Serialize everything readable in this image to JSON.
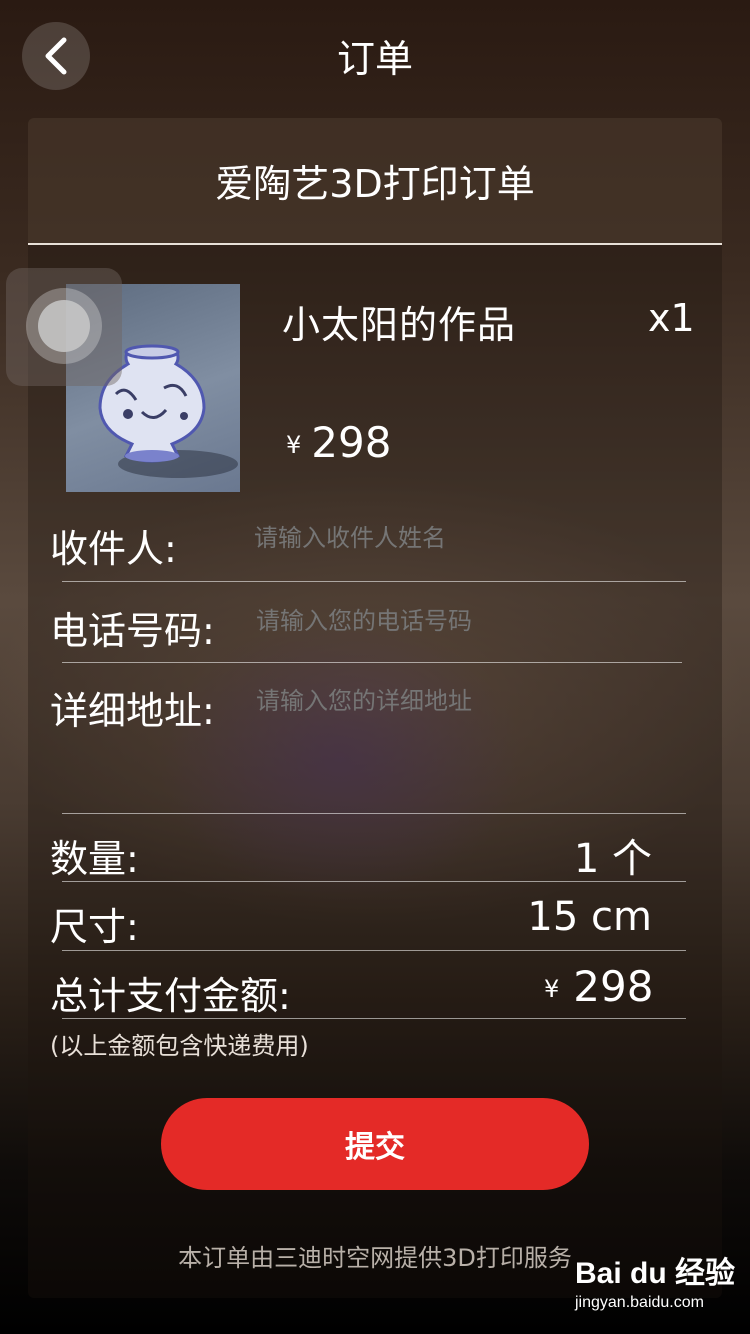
{
  "nav": {
    "title": "订单"
  },
  "card": {
    "title": "爱陶艺3D打印订单"
  },
  "product": {
    "name": "小太阳的作品",
    "quantity": "x1",
    "currency": "¥",
    "price": "298"
  },
  "form": {
    "recipient": {
      "label": "收件人:",
      "placeholder": "请输入收件人姓名"
    },
    "phone": {
      "label": "电话号码:",
      "placeholder": "请输入您的电话号码"
    },
    "address": {
      "label": "详细地址:",
      "placeholder": "请输入您的详细地址"
    }
  },
  "summary": {
    "quantity": {
      "label": "数量:",
      "value": "1 个"
    },
    "size": {
      "label": "尺寸:",
      "value": "15 cm"
    },
    "total": {
      "label": "总计支付金额:",
      "currency": "¥",
      "value": "298"
    },
    "note": "(以上金额包含快递费用)"
  },
  "submit_label": "提交",
  "footer": "本订单由三迪时空网提供3D打印服务",
  "watermark": {
    "logo": "Bai du 经验",
    "url": "jingyan.baidu.com"
  },
  "colors": {
    "submit": "#e42a27",
    "text": "#ffffff"
  }
}
